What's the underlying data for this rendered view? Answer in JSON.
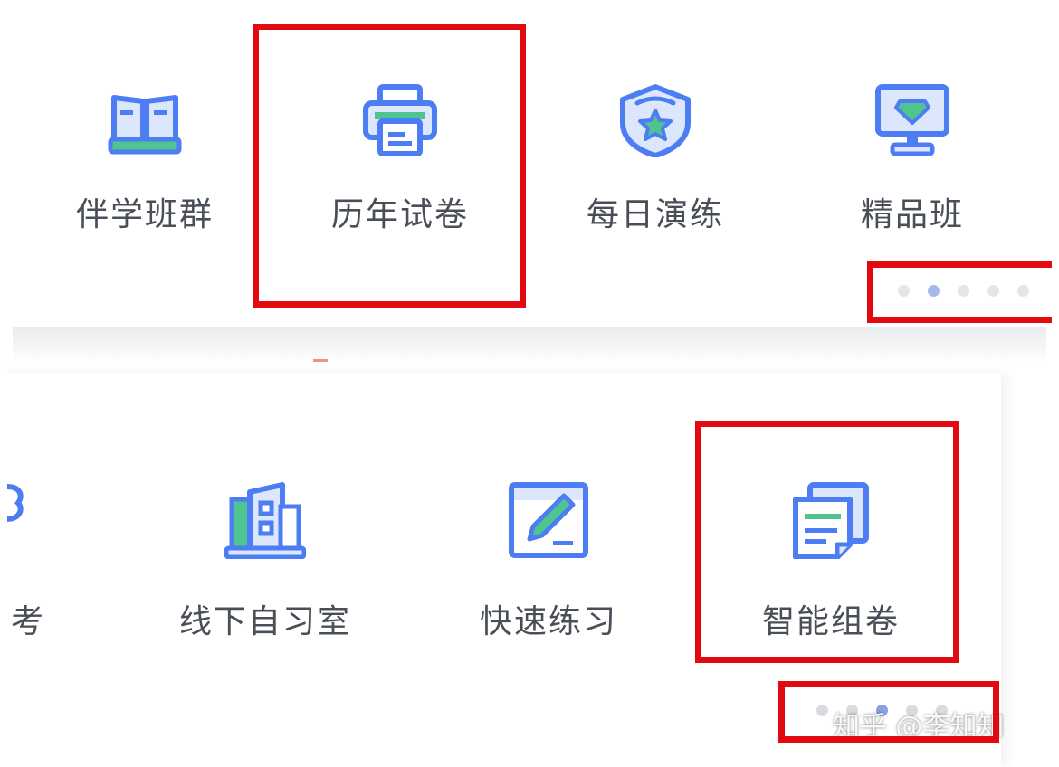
{
  "top_menu": {
    "items": [
      {
        "label": "伴学班群",
        "icon": "open-book-icon"
      },
      {
        "label": "历年试卷",
        "icon": "printer-icon"
      },
      {
        "label": "每日演练",
        "icon": "star-shield-icon"
      },
      {
        "label": "精品班",
        "icon": "monitor-diamond-icon"
      }
    ],
    "pager": {
      "count": 5,
      "active": 2
    }
  },
  "bottom_menu": {
    "partial_label": "考",
    "items": [
      {
        "label": "线下自习室",
        "icon": "building-icon"
      },
      {
        "label": "快速练习",
        "icon": "pencil-square-icon"
      },
      {
        "label": "智能组卷",
        "icon": "stacked-documents-icon"
      }
    ],
    "pager": {
      "count": 5,
      "active": 3
    }
  },
  "watermark": "知乎 @李知知",
  "colors": {
    "icon_blue": "#4d7df2",
    "icon_light": "#dce7fd",
    "icon_green": "#4fc48e",
    "highlight_red": "#e20a10",
    "label_gray": "#4a4f57"
  }
}
